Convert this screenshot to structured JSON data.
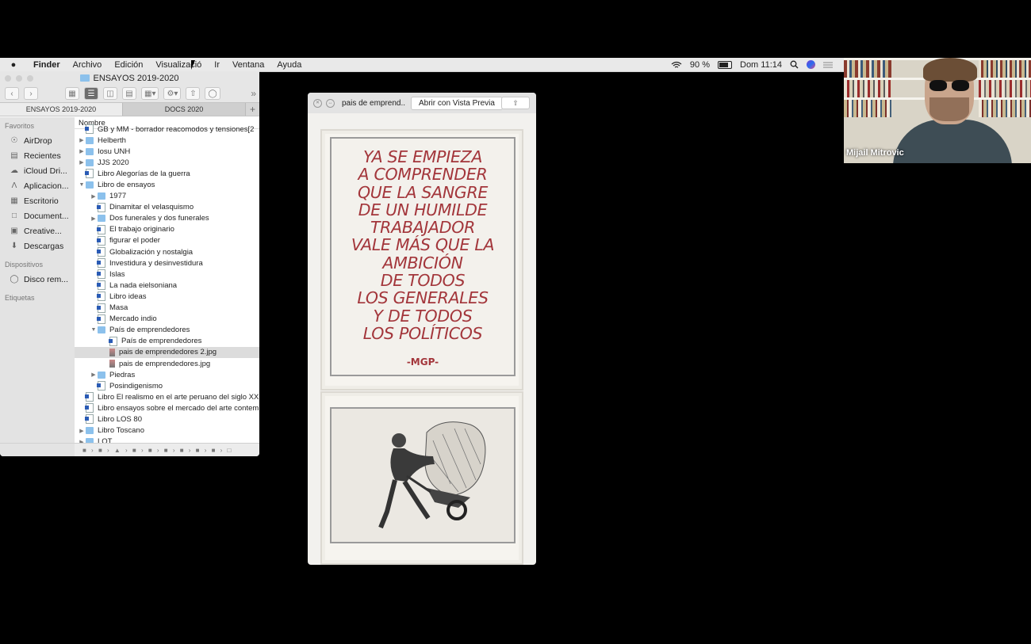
{
  "menubar": {
    "apple_icon": "apple-icon",
    "items": [
      "Finder",
      "Archivo",
      "Edición",
      "Visualizació",
      "Ir",
      "Ventana",
      "Ayuda"
    ],
    "battery_text": "90 %",
    "clock": "Dom 11:14"
  },
  "finder": {
    "window_title": "ENSAYOS 2019-2020",
    "tabs": [
      "ENSAYOS 2019-2020",
      "DOCS 2020"
    ],
    "tab_add": "+",
    "sidebar": {
      "favorites_header": "Favoritos",
      "favorites": [
        "AirDrop",
        "Recientes",
        "iCloud Dri...",
        "Aplicacion...",
        "Escritorio",
        "Document...",
        "Creative...",
        "Descargas"
      ],
      "devices_header": "Dispositivos",
      "devices": [
        "Disco rem..."
      ],
      "tags_header": "Etiquetas"
    },
    "column_header": "Nombre",
    "rows": [
      "GB y MM - borrador reacomodos y tensiones[2",
      "Helberth",
      "Iosu UNH",
      "JJS 2020",
      "Libro Alegorías de la guerra",
      "Libro de ensayos",
      "1977",
      "Dinamitar el velasquismo",
      "Dos funerales y dos funerales",
      "El trabajo originario",
      "figurar el poder",
      "Globalización y nostalgia",
      "Investidura y desinvestidura",
      "Islas",
      "La nada eielsoniana",
      "Libro ideas",
      "Masa",
      "Mercado indio",
      "País de emprendedores",
      "País de emprendedores",
      "pais de emprendedores 2.jpg",
      "pais de emprendedores.jpg",
      "Piedras",
      "Posindigenismo",
      "Libro El realismo en el arte peruano del siglo XX",
      "Libro ensayos sobre el mercado del arte contem",
      "Libro LOS 80",
      "Libro Toscano",
      "LOT"
    ]
  },
  "quicklook": {
    "title": "pais de emprend...",
    "open_button": "Abrir con Vista Previa",
    "poem_lines": [
      "YA SE EMPIEZA",
      "A COMPRENDER",
      "QUE LA SANGRE",
      "DE UN HUMILDE",
      "TRABAJADOR",
      "VALE MÁS QUE LA",
      "AMBICIÓN",
      "DE TODOS",
      "LOS GENERALES",
      "Y DE TODOS",
      "LOS POLÍTICOS"
    ],
    "signature": "-MGP-"
  },
  "video": {
    "participant_name": "Mijail Mitrovic"
  }
}
